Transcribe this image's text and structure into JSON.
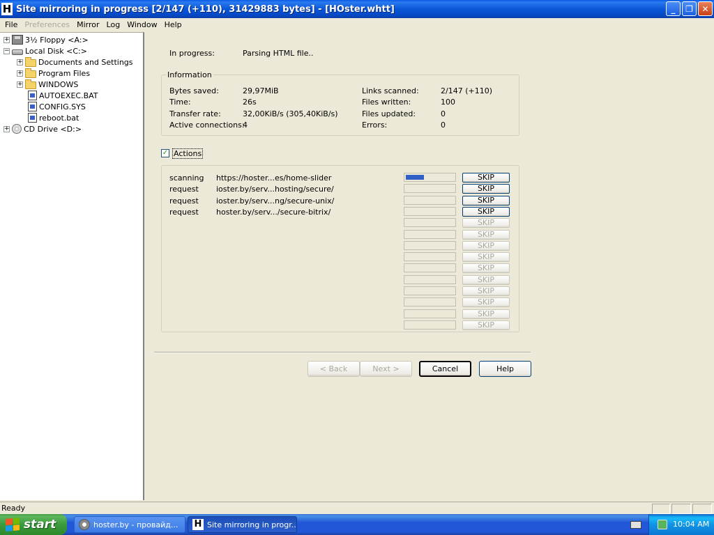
{
  "window": {
    "title": "Site mirroring in progress [2/147 (+110), 31429883 bytes] - [HOster.whtt]",
    "app_icon_letter": "H",
    "minimize_glyph": "_",
    "restore_glyph": "❐",
    "close_glyph": "✕"
  },
  "menu": [
    "File",
    "Preferences",
    "Mirror",
    "Log",
    "Window",
    "Help"
  ],
  "tree": {
    "items": [
      {
        "label": "3½ Floppy <A:>",
        "expander": "+",
        "icon": "floppy-icon"
      },
      {
        "label": "Local Disk <C:>",
        "expander": "−",
        "icon": "disk-icon"
      },
      {
        "label": "Documents and Settings",
        "expander": "+",
        "icon": "folder-icon"
      },
      {
        "label": "Program Files",
        "expander": "+",
        "icon": "folder-icon"
      },
      {
        "label": "WINDOWS",
        "expander": "+",
        "icon": "folder-icon"
      },
      {
        "label": "AUTOEXEC.BAT",
        "expander": "",
        "icon": "file-icon"
      },
      {
        "label": "CONFIG.SYS",
        "expander": "",
        "icon": "file-icon"
      },
      {
        "label": "reboot.bat",
        "expander": "",
        "icon": "file-icon"
      },
      {
        "label": "CD Drive <D:>",
        "expander": "+",
        "icon": "cd-icon"
      }
    ]
  },
  "progress": {
    "in_progress_label": "In progress:",
    "in_progress_value": "Parsing HTML file.."
  },
  "information": {
    "title": "Information",
    "bytes_saved_label": "Bytes saved:",
    "bytes_saved_value": "29,97MiB",
    "time_label": "Time:",
    "time_value": "26s",
    "transfer_rate_label": "Transfer rate:",
    "transfer_rate_value": "32,00KiB/s (305,40KiB/s)",
    "active_connections_label": "Active connections:",
    "active_connections_value": "4",
    "links_scanned_label": "Links scanned:",
    "links_scanned_value": "2/147 (+110)",
    "files_written_label": "Files written:",
    "files_written_value": "100",
    "files_updated_label": "Files updated:",
    "files_updated_value": "0",
    "errors_label": "Errors:",
    "errors_value": "0"
  },
  "actions": {
    "label": "Actions",
    "checked_glyph": "✓",
    "skip_label": "SKIP",
    "rows": [
      {
        "action": "scanning",
        "url": "https://hoster...es/home-slider",
        "progress": 0.38
      },
      {
        "action": "request",
        "url": "ioster.by/serv...hosting/secure/",
        "progress": 0
      },
      {
        "action": "request",
        "url": "ioster.by/serv...ng/secure-unix/",
        "progress": 0
      },
      {
        "action": "request",
        "url": "hoster.by/serv.../secure-bitrix/",
        "progress": 0
      }
    ],
    "empty_rows": 10
  },
  "buttons": {
    "back": "< Back",
    "next": "Next >",
    "cancel": "Cancel",
    "help": "Help"
  },
  "status": {
    "text": "Ready"
  },
  "taskbar": {
    "start": "start",
    "tasks": [
      {
        "label": "hoster.by - провайд...",
        "active": false
      },
      {
        "label": "Site mirroring in progr...",
        "active": true
      }
    ],
    "clock": "10:04 AM"
  }
}
